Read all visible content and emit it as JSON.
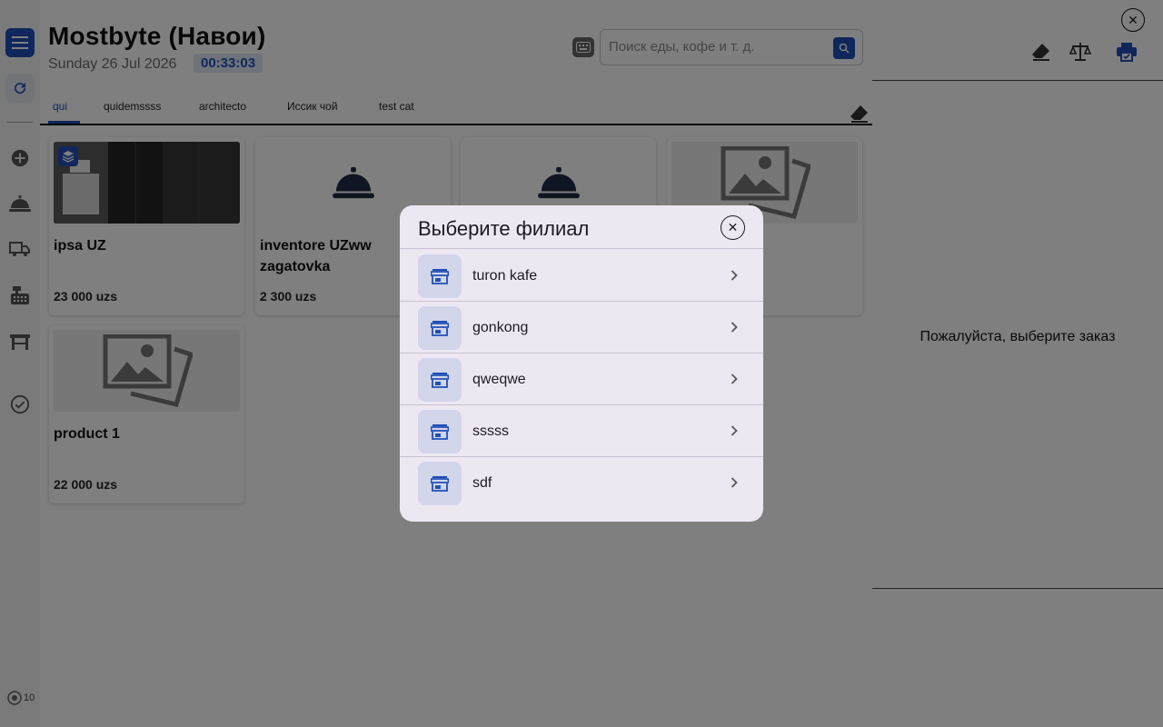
{
  "header": {
    "title": "Mostbyte (Навои)",
    "date": "Sunday 26 Jul 2026",
    "time": "00:33:03",
    "search_placeholder": "Поиск еды, кофе и т. д."
  },
  "tabs": [
    {
      "label": "qui",
      "active": true
    },
    {
      "label": "quidemssss"
    },
    {
      "label": "architecto"
    },
    {
      "label": "Иссик чой"
    },
    {
      "label": "test cat"
    }
  ],
  "products": [
    {
      "name": "ipsa UZ",
      "price": "23 000 uzs",
      "image": "photo-wardrobe",
      "has_variants_icon": "layers-icon"
    },
    {
      "name": "inventore UZww zagatovka",
      "price": "2 300 uzs",
      "image": "cloche-icon"
    },
    {
      "name": "",
      "price": "",
      "image": "cloche-icon"
    },
    {
      "name": "",
      "price": "",
      "image": "image-placeholder-icon"
    },
    {
      "name": "product 1",
      "price": "22 000 uzs",
      "image": "image-placeholder-icon"
    }
  ],
  "sidebar": {
    "icons": [
      "menu-icon",
      "refresh-icon",
      "add-icon",
      "cloche-icon",
      "delivery-truck-icon",
      "cash-register-icon",
      "table-icon",
      "check-circle-icon"
    ],
    "version": "10"
  },
  "right_panel": {
    "empty_message": "Пожалуйста, выберите заказ",
    "tools": [
      "eraser-icon",
      "scale-icon",
      "printer-icon"
    ]
  },
  "modal": {
    "title": "Выберите филиал",
    "branches": [
      {
        "label": "turon kafe"
      },
      {
        "label": "gonkong"
      },
      {
        "label": "qweqwe"
      },
      {
        "label": "sssss"
      },
      {
        "label": "sdf"
      }
    ]
  },
  "colors": {
    "accent": "#1f4fb8",
    "overlay": "rgba(0,0,0,0.5)",
    "modal_bg": "#ece7f1",
    "branch_icon_bg": "#d3d5ea"
  }
}
